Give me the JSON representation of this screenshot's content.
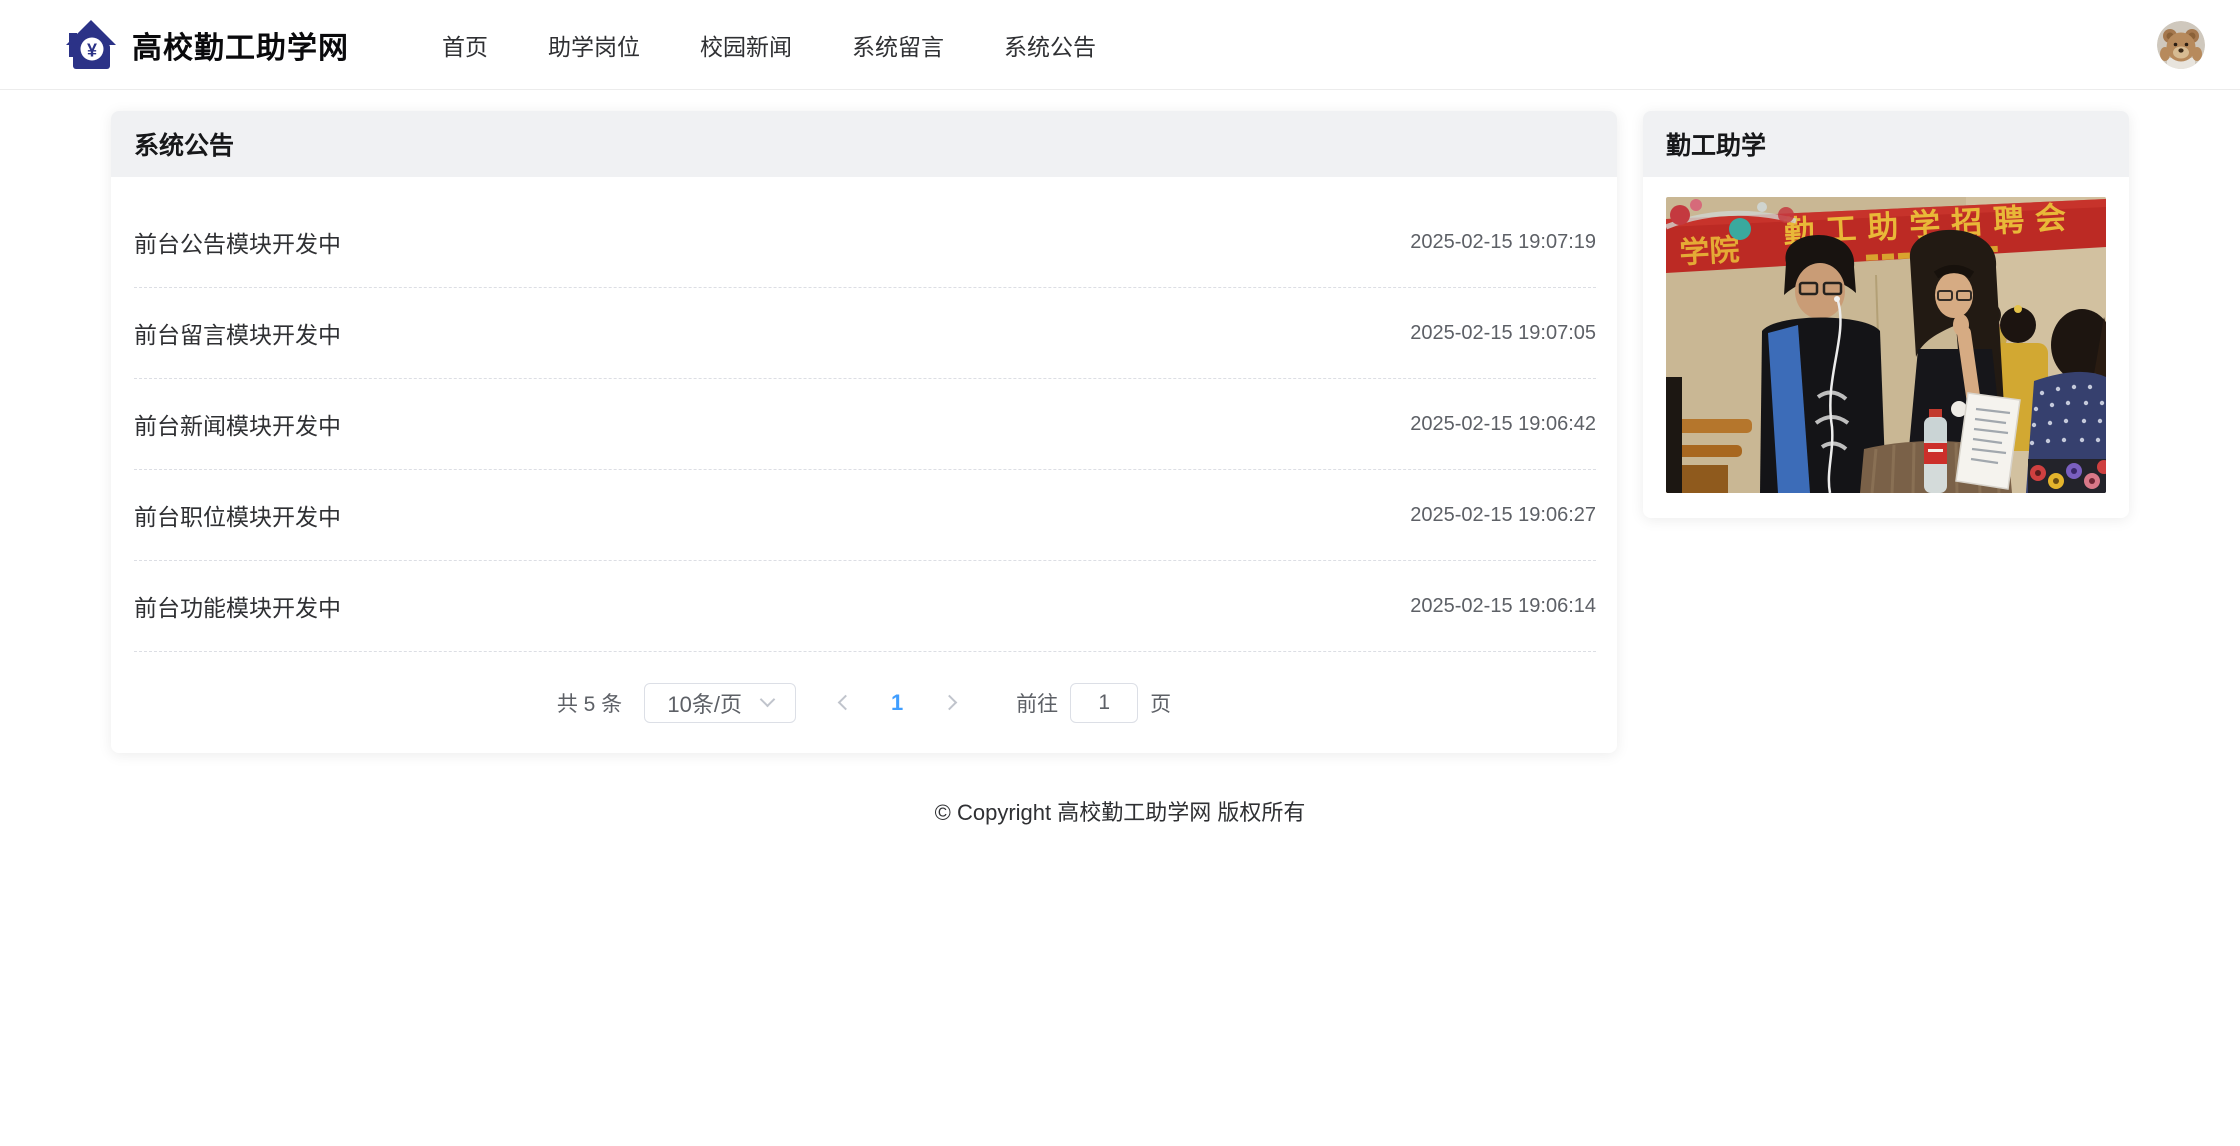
{
  "header": {
    "brand": {
      "title": "高校勤工助学网",
      "logo_symbol": "¥"
    },
    "nav_items": [
      {
        "label": "首页"
      },
      {
        "label": "助学岗位"
      },
      {
        "label": "校园新闻"
      },
      {
        "label": "系统留言"
      },
      {
        "label": "系统公告"
      }
    ]
  },
  "main": {
    "panel_title": "系统公告",
    "announcements": [
      {
        "title": "前台公告模块开发中",
        "time": "2025-02-15 19:07:19"
      },
      {
        "title": "前台留言模块开发中",
        "time": "2025-02-15 19:07:05"
      },
      {
        "title": "前台新闻模块开发中",
        "time": "2025-02-15 19:06:42"
      },
      {
        "title": "前台职位模块开发中",
        "time": "2025-02-15 19:06:27"
      },
      {
        "title": "前台功能模块开发中",
        "time": "2025-02-15 19:06:14"
      }
    ],
    "pagination": {
      "total": "共 5 条",
      "page_size": "10条/页",
      "current_page": "1",
      "goto_label": "前往",
      "goto_value": "1",
      "goto_unit": "页"
    }
  },
  "sidebar": {
    "panel_title": "勤工助学",
    "photo": {
      "banner_text_left": "学院",
      "banner_text": "勤工助学招聘会"
    }
  },
  "footer": {
    "copyright": "© Copyright 高校勤工助学网 版权所有"
  },
  "colors": {
    "accent_blue": "#409EFF",
    "logo_navy": "#2b3287",
    "panel_header_bg": "#f0f1f3",
    "disabled_gray": "#c0c4cc",
    "banner_red": "#bc2a24",
    "banner_text_yellow": "#e9b838"
  },
  "icons": {
    "logo": "house-with-yuan-icon",
    "page_size_chevron": "chevron-down",
    "prev_page": "chevron-left",
    "next_page": "chevron-right",
    "avatar": "teddy-bear-avatar"
  }
}
